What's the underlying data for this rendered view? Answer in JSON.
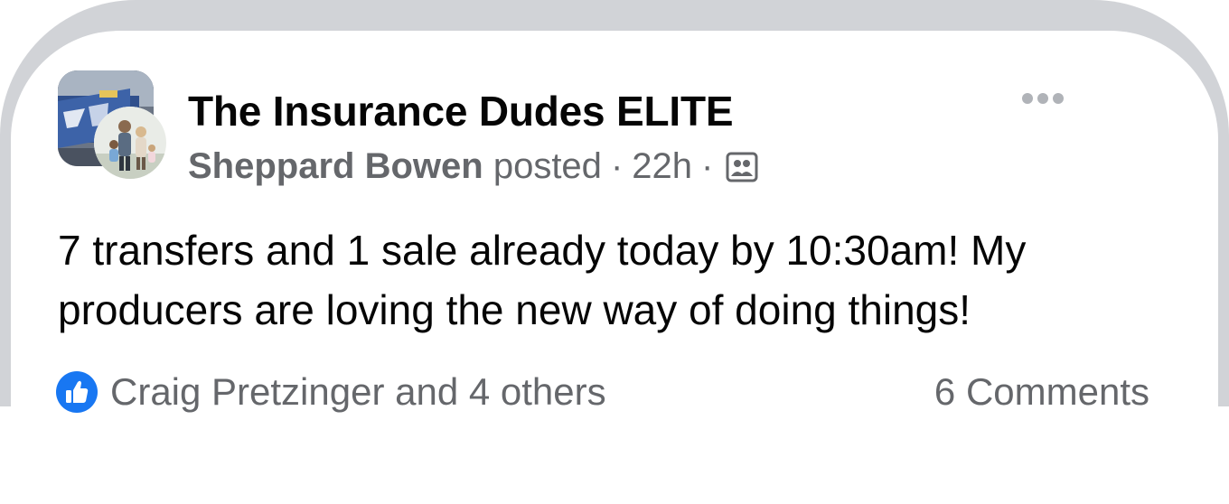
{
  "post": {
    "group_name": "The Insurance Dudes ELITE",
    "author": "Sheppard Bowen",
    "action": "posted",
    "separator": "·",
    "time": "22h",
    "audience_icon": "group-members-icon",
    "more_icon": "more-options-icon",
    "body_lines": [
      "7 transfers and 1 sale already today by 10:30am! My",
      "producers are loving the new way of doing things!"
    ]
  },
  "footer": {
    "reaction_icon": "like-icon",
    "reactions_text": "Craig Pretzinger and 4 others",
    "comments_text": "6 Comments"
  },
  "colors": {
    "primary_text": "#050505",
    "secondary_text": "#65676b",
    "like_blue": "#1877f2",
    "frame_gray": "#d1d3d7"
  }
}
